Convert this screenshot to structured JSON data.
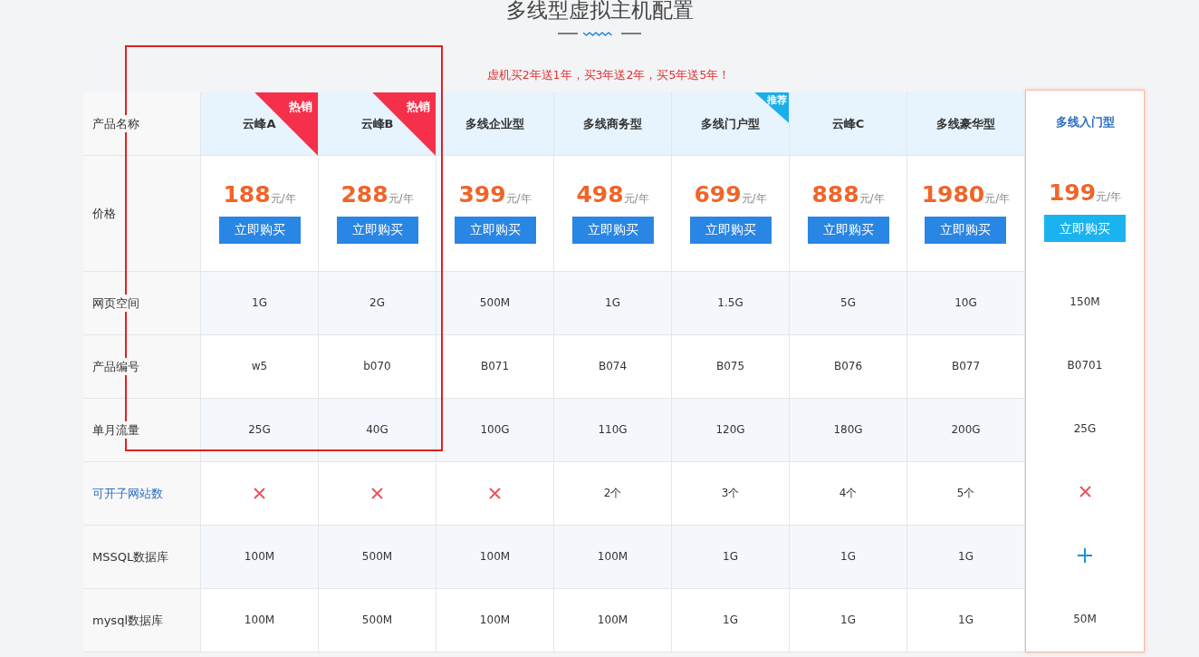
{
  "title": "多线型虚拟主机配置",
  "promo": "虚机买2年送1年，买3年送2年，买5年送5年！",
  "row_labels": [
    {
      "text": "产品名称",
      "link": false
    },
    {
      "text": "价格",
      "link": false
    },
    {
      "text": "网页空间",
      "link": false
    },
    {
      "text": "产品编号",
      "link": false
    },
    {
      "text": "单月流量",
      "link": false
    },
    {
      "text": "可开子网站数",
      "link": true
    },
    {
      "text": "MSSQL数据库",
      "link": false
    },
    {
      "text": "mysql数据库",
      "link": false
    }
  ],
  "products": [
    {
      "name": "云峰A",
      "badge": {
        "kind": "hot",
        "text": "热销"
      },
      "price": "188",
      "unit": "元/年",
      "button": "立即购买",
      "cells": [
        {
          "kind": "text",
          "text": "1G"
        },
        {
          "kind": "text",
          "text": "w5"
        },
        {
          "kind": "text",
          "text": "25G"
        },
        {
          "kind": "cross"
        },
        {
          "kind": "text",
          "text": "100M"
        },
        {
          "kind": "text",
          "text": "100M"
        }
      ]
    },
    {
      "name": "云峰B",
      "badge": {
        "kind": "hot",
        "text": "热销"
      },
      "price": "288",
      "unit": "元/年",
      "button": "立即购买",
      "cells": [
        {
          "kind": "text",
          "text": "2G"
        },
        {
          "kind": "text",
          "text": "b070"
        },
        {
          "kind": "text",
          "text": "40G"
        },
        {
          "kind": "cross"
        },
        {
          "kind": "text",
          "text": "500M"
        },
        {
          "kind": "text",
          "text": "500M"
        }
      ]
    },
    {
      "name": "多线企业型",
      "price": "399",
      "unit": "元/年",
      "button": "立即购买",
      "cells": [
        {
          "kind": "text",
          "text": "500M"
        },
        {
          "kind": "text",
          "text": "B071"
        },
        {
          "kind": "text",
          "text": "100G"
        },
        {
          "kind": "cross"
        },
        {
          "kind": "text",
          "text": "100M"
        },
        {
          "kind": "text",
          "text": "100M"
        }
      ]
    },
    {
      "name": "多线商务型",
      "price": "498",
      "unit": "元/年",
      "button": "立即购买",
      "cells": [
        {
          "kind": "text",
          "text": "1G"
        },
        {
          "kind": "text",
          "text": "B074"
        },
        {
          "kind": "text",
          "text": "110G"
        },
        {
          "kind": "text",
          "text": "2个"
        },
        {
          "kind": "text",
          "text": "100M"
        },
        {
          "kind": "text",
          "text": "100M"
        }
      ]
    },
    {
      "name": "多线门户型",
      "badge": {
        "kind": "recommend",
        "text": "推荐"
      },
      "price": "699",
      "unit": "元/年",
      "button": "立即购买",
      "cells": [
        {
          "kind": "text",
          "text": "1.5G"
        },
        {
          "kind": "text",
          "text": "B075"
        },
        {
          "kind": "text",
          "text": "120G"
        },
        {
          "kind": "text",
          "text": "3个"
        },
        {
          "kind": "text",
          "text": "1G"
        },
        {
          "kind": "text",
          "text": "1G"
        }
      ]
    },
    {
      "name": "云峰C",
      "price": "888",
      "unit": "元/年",
      "button": "立即购买",
      "cells": [
        {
          "kind": "text",
          "text": "5G"
        },
        {
          "kind": "text",
          "text": "B076"
        },
        {
          "kind": "text",
          "text": "180G"
        },
        {
          "kind": "text",
          "text": "4个"
        },
        {
          "kind": "text",
          "text": "1G"
        },
        {
          "kind": "text",
          "text": "1G"
        }
      ]
    },
    {
      "name": "多线豪华型",
      "price": "1980",
      "unit": "元/年",
      "button": "立即购买",
      "cells": [
        {
          "kind": "text",
          "text": "10G"
        },
        {
          "kind": "text",
          "text": "B077"
        },
        {
          "kind": "text",
          "text": "200G"
        },
        {
          "kind": "text",
          "text": "5个"
        },
        {
          "kind": "text",
          "text": "1G"
        },
        {
          "kind": "text",
          "text": "1G"
        }
      ]
    }
  ],
  "featured": {
    "name": "多线入门型",
    "price": "199",
    "unit": "元/年",
    "button": "立即购买",
    "cells": [
      {
        "kind": "text",
        "text": "150M"
      },
      {
        "kind": "text",
        "text": "B0701"
      },
      {
        "kind": "text",
        "text": "25G"
      },
      {
        "kind": "cross"
      },
      {
        "kind": "plus"
      },
      {
        "kind": "text",
        "text": "50M"
      }
    ]
  },
  "highlight": true
}
